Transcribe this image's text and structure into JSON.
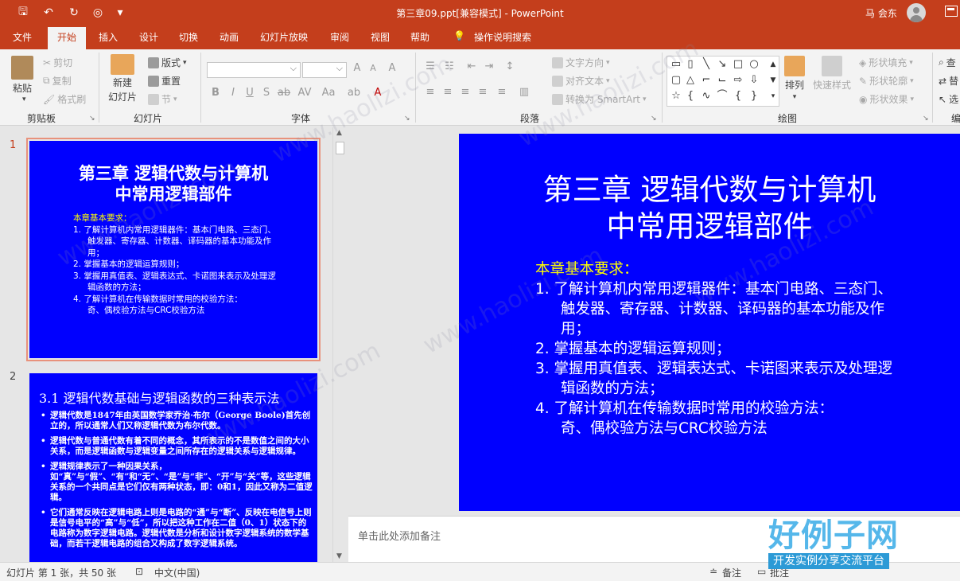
{
  "window": {
    "title": "第三章09.ppt[兼容模式]  -  PowerPoint",
    "user_name": "马 会东"
  },
  "tabs": [
    "文件",
    "开始",
    "插入",
    "设计",
    "切换",
    "动画",
    "幻灯片放映",
    "审阅",
    "视图",
    "帮助",
    "操作说明搜索"
  ],
  "ribbon": {
    "clipboard": {
      "label": "剪贴板",
      "paste": "粘贴",
      "cut": "剪切",
      "copy": "复制",
      "format_painter": "格式刷"
    },
    "slides": {
      "label": "幻灯片",
      "new_slide_1": "新建",
      "new_slide_2": "幻灯片",
      "layout": "版式",
      "reset": "重置",
      "section": "节"
    },
    "font": {
      "label": "字体"
    },
    "paragraph": {
      "label": "段落",
      "text_direction": "文字方向",
      "align_text": "对齐文本",
      "smartart": "转换为 SmartArt"
    },
    "drawing": {
      "label": "绘图",
      "arrange": "排列",
      "quick_styles": "快速样式",
      "shape_fill": "形状填充",
      "shape_outline": "形状轮廓",
      "shape_effects": "形状效果"
    },
    "editing": {
      "find": "查",
      "replace": "替",
      "select": "选",
      "label": "编"
    }
  },
  "thumbnails": {
    "slide1_number": "1",
    "slide2_number": "2",
    "slide2_title": "3.1  逻辑代数基础与逻辑函数的三种表示法",
    "slide2_bullets": [
      "逻辑代数是1847年由英国数学家乔治·布尔（George Boole)首先创立的，所以通常人们又称逻辑代数为布尔代数。",
      "逻辑代数与普通代数有着不同的概念，其所表示的不是数值之间的大小关系，而是逻辑函数与逻辑变量之间所存在的逻辑关系与逻辑规律。",
      "逻辑规律表示了一种因果关系，如“真”与“假”、“有”和“无”、“是”与“非”、“开”与“关”等，这些逻辑关系的一个共同点是它们仅有两种状态，即：0和1，因此又称为二值逻辑。",
      "它们通常反映在逻辑电路上则是电路的“通”与“断”、反映在电信号上则是信号电平的“高”与“低”，所以把这种工作在二值（0、1）状态下的电路称为数字逻辑电路。逻辑代数是分析和设计数字逻辑系统的数学基础，而若干逻辑电路的组合又构成了数字逻辑系统。"
    ]
  },
  "slide": {
    "title_line1": "第三章    逻辑代数与计算机",
    "title_line2": "中常用逻辑部件",
    "requirements_heading": "本章基本要求：",
    "lines": [
      "1.  了解计算机内常用逻辑器件：基本门电路、三态门、",
      "触发器、寄存器、计数器、译码器的基本功能及作用；",
      "2.  掌握基本的逻辑运算规则；",
      "3.  掌握用真值表、逻辑表达式、卡诺图来表示及处理逻",
      "辑函数的方法；",
      "4.  了解计算机在传输数据时常用的校验方法：",
      "奇、偶校验方法与CRC校验方法"
    ]
  },
  "thumb1": {
    "title_line1": "第三章    逻辑代数与计算机",
    "title_line2": "中常用逻辑部件"
  },
  "notes_placeholder": "单击此处添加备注",
  "status": {
    "slide_info": "幻灯片 第 1 张，共 50 张",
    "language": "中文(中国)",
    "notes_button": "备注",
    "comments_button": "批注"
  },
  "watermark": {
    "text": "www.haolizi.com",
    "logo_big": "好例子网",
    "logo_small": "开发实例分享交流平台"
  }
}
